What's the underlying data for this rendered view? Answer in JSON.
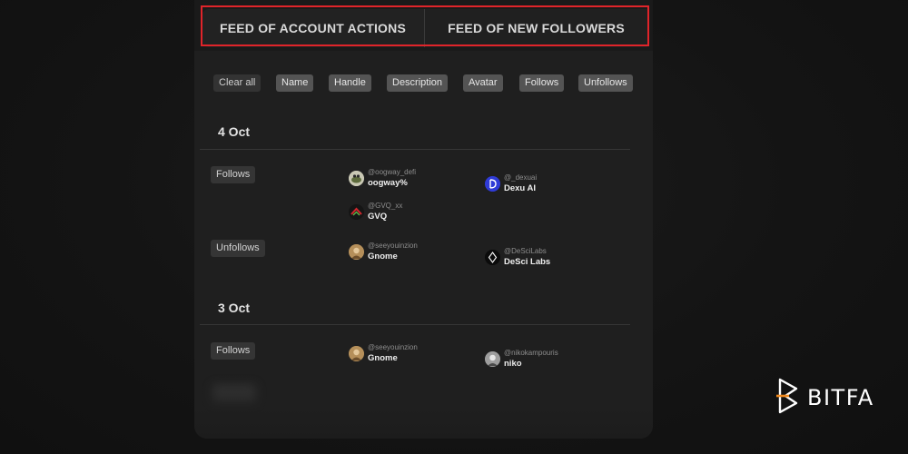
{
  "tabs": [
    {
      "label": "FEED OF ACCOUNT ACTIONS"
    },
    {
      "label": "FEED OF NEW FOLLOWERS"
    }
  ],
  "filters": {
    "clear_label": "Clear all",
    "chips": [
      "Name",
      "Handle",
      "Description",
      "Avatar",
      "Follows",
      "Unfollows"
    ]
  },
  "feed": [
    {
      "date": "4 Oct",
      "groups": [
        {
          "action": "Follows",
          "users": [
            {
              "handle": "@oogway_defi",
              "name": "oogway%",
              "avatar_icon": "turtle-avatar-icon"
            },
            {
              "handle": "@_dexuai",
              "name": "Dexu AI",
              "avatar_icon": "dexu-logo-icon"
            },
            {
              "handle": "@GVQ_xx",
              "name": "GVQ",
              "avatar_icon": "gvq-logo-icon"
            }
          ]
        },
        {
          "action": "Unfollows",
          "users": [
            {
              "handle": "@seeyouinzion",
              "name": "Gnome",
              "avatar_icon": "gnome-avatar-icon"
            },
            {
              "handle": "@DeSciLabs",
              "name": "DeSci Labs",
              "avatar_icon": "desci-logo-icon"
            }
          ]
        }
      ]
    },
    {
      "date": "3 Oct",
      "groups": [
        {
          "action": "Follows",
          "users": [
            {
              "handle": "@seeyouinzion",
              "name": "Gnome",
              "avatar_icon": "gnome-avatar-icon"
            },
            {
              "handle": "@nikokampouris",
              "name": "niko",
              "avatar_icon": "niko-avatar-icon"
            }
          ]
        }
      ]
    }
  ],
  "brand": {
    "name": "BITFA"
  },
  "colors": {
    "highlight": "#e0242a",
    "panel": "#1f1f1f",
    "chip": "#545454",
    "dexu_blue": "#2f3bd6"
  }
}
